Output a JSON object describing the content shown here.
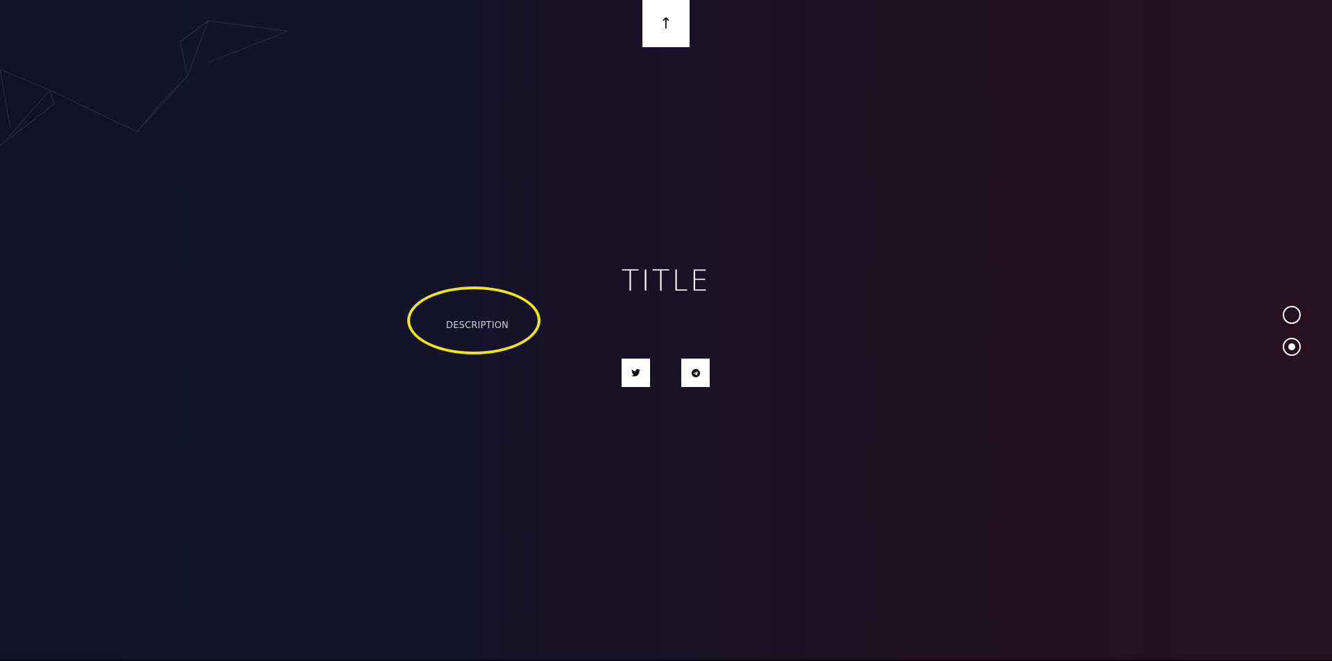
{
  "page": {
    "title": "TITLE",
    "description": "DESCRIPTION"
  },
  "scroll_top": {
    "label": "↑",
    "icon": "arrow-up-icon"
  },
  "social_links": [
    {
      "name": "twitter",
      "icon": "twitter-icon"
    },
    {
      "name": "telegram",
      "icon": "telegram-icon"
    }
  ],
  "section_nav": {
    "count": 2,
    "active_index": 1
  },
  "colors": {
    "highlight": "#f0e612",
    "background_left": "#0f1328",
    "background_right": "#28111f",
    "button_bg": "#ffffff"
  }
}
